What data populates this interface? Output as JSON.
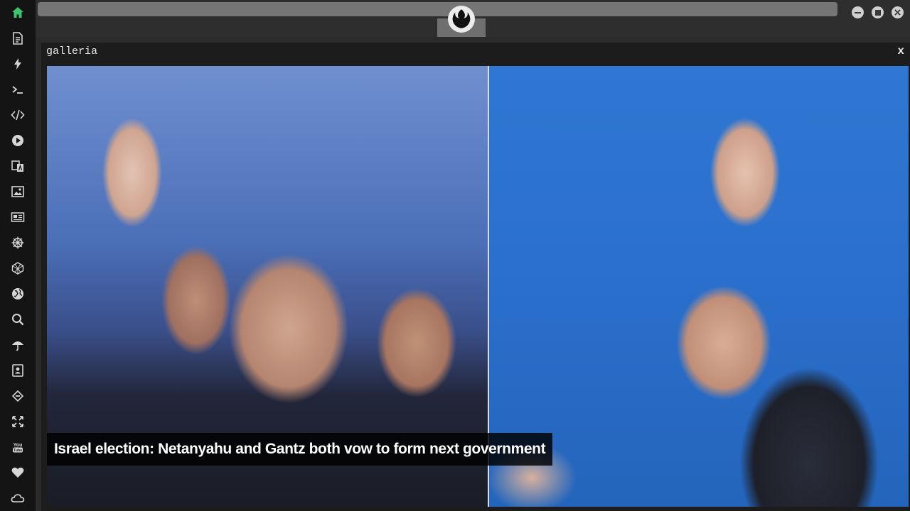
{
  "sidebar": {
    "items": [
      {
        "icon": "home-icon",
        "active_color": "#3ec46d"
      },
      {
        "icon": "document-icon"
      },
      {
        "icon": "lightning-icon"
      },
      {
        "icon": "terminal-icon"
      },
      {
        "icon": "code-icon"
      },
      {
        "icon": "play-icon"
      },
      {
        "icon": "translate-icon"
      },
      {
        "icon": "image-icon"
      },
      {
        "icon": "newspaper-icon"
      },
      {
        "icon": "helm-icon"
      },
      {
        "icon": "cube-icon"
      },
      {
        "icon": "globe-icon"
      },
      {
        "icon": "search-icon"
      },
      {
        "icon": "umbrella-icon"
      },
      {
        "icon": "contact-card-icon"
      },
      {
        "icon": "link-icon"
      },
      {
        "icon": "expand-icon"
      },
      {
        "icon": "youtube-icon"
      },
      {
        "icon": "heart-icon"
      },
      {
        "icon": "cloud-icon"
      }
    ]
  },
  "window": {
    "emblem": "rebel-alliance-emblem-icon",
    "controls": [
      "minimize-icon",
      "maximize-icon",
      "close-icon"
    ]
  },
  "panel": {
    "title": "galleria",
    "close_label": "x",
    "caption": "Israel election: Netanyahu and Gantz both vow to form next government"
  }
}
